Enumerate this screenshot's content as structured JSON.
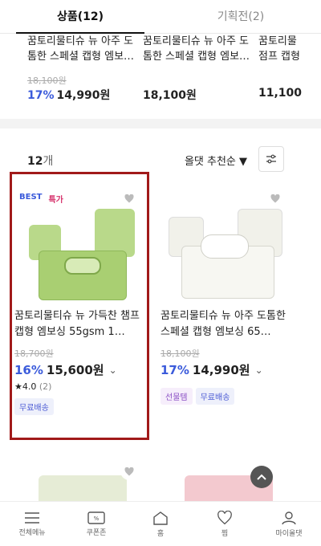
{
  "tabs": [
    {
      "label": "상품(12)",
      "active": true
    },
    {
      "label": "기획전(2)",
      "active": false
    }
  ],
  "hrow": [
    {
      "name": "꿈토리물티슈 뉴 아주 도톰한 스페셜 캡형 엠보…",
      "orig": "18,100원",
      "discount": "17%",
      "price": "14,990원"
    },
    {
      "name": "꿈토리물티슈 뉴 아주 도톰한 스페셜 캡형 엠보…",
      "orig": "",
      "discount": "",
      "price": "18,100원"
    },
    {
      "name": "꿈토리물 점프 캡형",
      "orig": "",
      "discount": "",
      "price": "11,100"
    }
  ],
  "listbar": {
    "count": "12",
    "count_unit": "개",
    "sort_label": "올댓 추천순 ▼"
  },
  "products": [
    {
      "tags": {
        "best": "BEST",
        "special": "특가"
      },
      "name": "꿈토리물티슈 뉴 가득찬 챔프 캡형 엠보싱 55gsm 1…",
      "orig": "18,700원",
      "discount": "16%",
      "price": "15,600원",
      "rating": "★4.0",
      "rating_count": "(2)",
      "badges": [
        {
          "label": "무료배송",
          "kind": "free"
        }
      ],
      "pack_color": "#b9d98a"
    },
    {
      "name": "꿈토리물티슈 뉴 아주 도톰한 스페셜 캡형 엠보싱 65…",
      "orig": "18,100원",
      "discount": "17%",
      "price": "14,990원",
      "badges": [
        {
          "label": "선물템",
          "kind": "gift"
        },
        {
          "label": "무료배송",
          "kind": "free"
        }
      ],
      "pack_color": "#f1f1ea"
    }
  ],
  "bottom_nav": [
    {
      "label": "전체메뉴",
      "icon": "menu-icon"
    },
    {
      "label": "쿠폰존",
      "icon": "coupon-icon"
    },
    {
      "label": "홈",
      "icon": "home-icon"
    },
    {
      "label": "찜",
      "icon": "heart-icon"
    },
    {
      "label": "마이올댓",
      "icon": "user-icon"
    }
  ],
  "colors": {
    "accent": "#3b5bdb",
    "highlight": "#a11a1a"
  }
}
